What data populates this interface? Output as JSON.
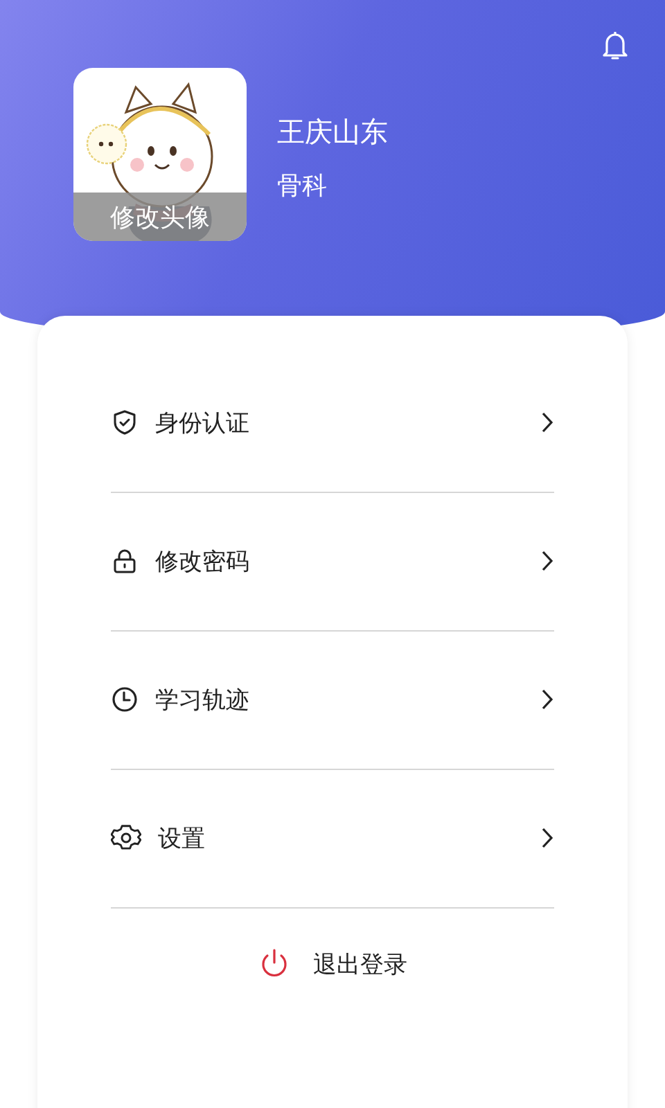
{
  "profile": {
    "avatar_label": "修改头像",
    "name": "王庆山东",
    "department": "骨科"
  },
  "menu": [
    {
      "kind": "shield",
      "label": "身份认证"
    },
    {
      "kind": "lock",
      "label": "修改密码"
    },
    {
      "kind": "clock",
      "label": "学习轨迹"
    },
    {
      "kind": "gear",
      "label": "设置"
    }
  ],
  "logout": {
    "label": "退出登录"
  }
}
